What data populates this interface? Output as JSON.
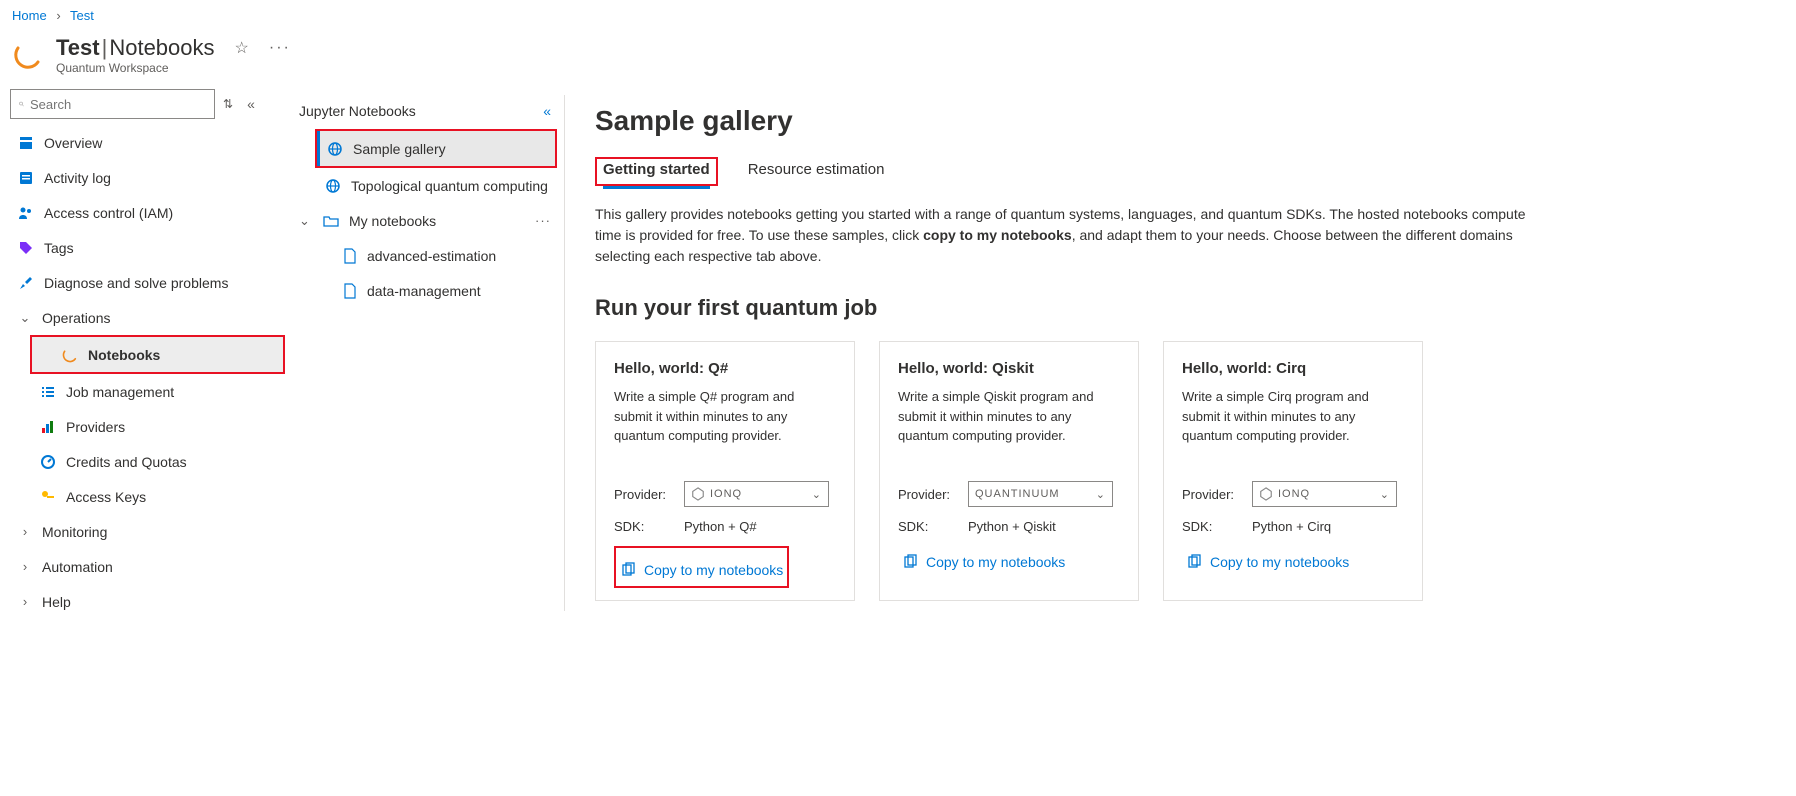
{
  "breadcrumb": {
    "home": "Home",
    "test": "Test"
  },
  "header": {
    "workspace": "Test",
    "divider": "|",
    "section": "Notebooks",
    "subtitle": "Quantum Workspace"
  },
  "sidebar": {
    "search_placeholder": "Search",
    "items": {
      "overview": "Overview",
      "activity_log": "Activity log",
      "access_control": "Access control (IAM)",
      "tags": "Tags",
      "diagnose": "Diagnose and solve problems",
      "operations": "Operations",
      "notebooks": "Notebooks",
      "job_management": "Job management",
      "providers": "Providers",
      "credits": "Credits and Quotas",
      "access_keys": "Access Keys",
      "monitoring": "Monitoring",
      "automation": "Automation",
      "help": "Help"
    }
  },
  "tree": {
    "header": "Jupyter Notebooks",
    "sample_gallery": "Sample gallery",
    "topological": "Topological quantum computing",
    "my_notebooks": "My notebooks",
    "file_adv": "advanced-estimation",
    "file_data": "data-management"
  },
  "content": {
    "title": "Sample gallery",
    "tab_getting": "Getting started",
    "tab_resource": "Resource estimation",
    "desc_before": "This gallery provides notebooks getting you started with a range of quantum systems, languages, and quantum SDKs. The hosted notebooks compute time is provided for free. To use these samples, click ",
    "desc_bold": "copy to my notebooks",
    "desc_after": ", and adapt them to your needs. Choose between the different domains selecting each respective tab above.",
    "section_heading": "Run your first quantum job",
    "provider_label": "Provider:",
    "sdk_label": "SDK:",
    "copy_label": "Copy to my notebooks",
    "cards": [
      {
        "title": "Hello, world: Q#",
        "desc": "Write a simple Q# program and submit it within minutes to any quantum computing provider.",
        "provider": "IONQ",
        "sdk": "Python + Q#"
      },
      {
        "title": "Hello, world: Qiskit",
        "desc": "Write a simple Qiskit program and submit it within minutes to any quantum computing provider.",
        "provider": "QUANTINUUM",
        "sdk": "Python + Qiskit"
      },
      {
        "title": "Hello, world: Cirq",
        "desc": "Write a simple Cirq program and submit it within minutes to any quantum computing provider.",
        "provider": "IONQ",
        "sdk": "Python + Cirq"
      }
    ]
  }
}
